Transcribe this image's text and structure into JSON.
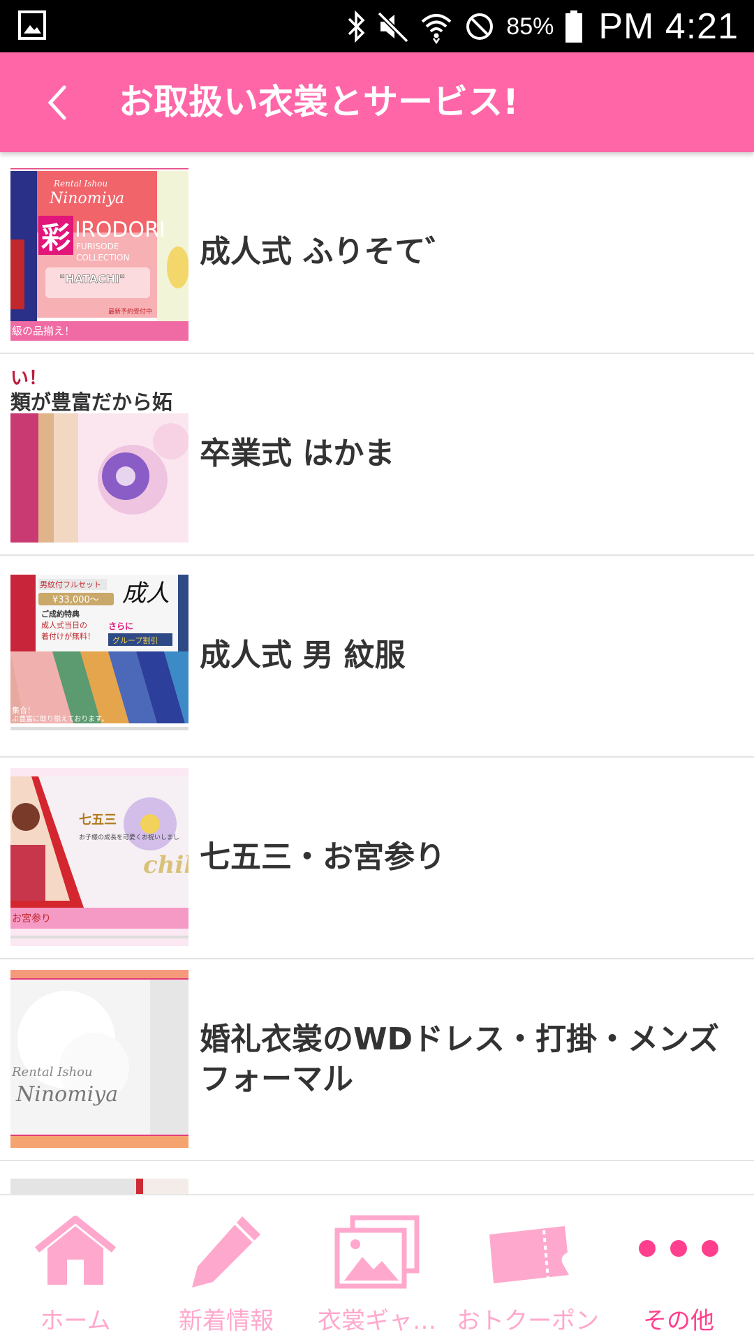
{
  "status_bar": {
    "battery": "85%",
    "time": "PM 4:21",
    "icons": [
      "gallery-icon",
      "bluetooth-icon",
      "mute-icon",
      "wifi-icon",
      "do-not-disturb-icon",
      "battery-icon"
    ]
  },
  "app_bar": {
    "back_icon": "chevron-left-icon",
    "title": "お取扱い衣裳とサービス!",
    "color": "#ff66a8"
  },
  "list": {
    "items": [
      {
        "label": "成人式 ふりそて゛",
        "thumb": {
          "brand": "Rental Ishou",
          "name": "Ninomiya",
          "kanji": "彩",
          "title": "IRODORI",
          "sub1": "FURISODE",
          "sub2": "COLLECTION",
          "tag": "\"HATACHI\"",
          "note": "最新予約受付中",
          "banner": "級の品揃え！"
        }
      },
      {
        "label": "卒業式 はかま",
        "thumb": {
          "top": "い！",
          "headline": "類が豊富だから妬"
        }
      },
      {
        "label": "成人式 男 紋服",
        "thumb": {
          "badge": "男紋付フルセット",
          "price": "¥33,000～",
          "kanji": "成人",
          "perk_title": "ご成約特典",
          "perk1": "成人式当日の",
          "perk2": "着付けが無料！",
          "more": "さらに",
          "group": "グループ割引",
          "foot1": "集合！",
          "foot2": "ぶ豊富に取り揃えております。"
        }
      },
      {
        "label": "七五三・お宮参り",
        "thumb": {
          "title": "七五三",
          "caption": "お子様の成長を可愛くお祝いしまし",
          "deco": "chil",
          "banner": "お宮参り"
        }
      },
      {
        "label": "婚礼衣裳のWDドレス・打掛・メンズフォーマル",
        "thumb": {
          "brand": "Rental Ishou",
          "name": "Ninomiya"
        }
      }
    ]
  },
  "bottom_nav": {
    "items": [
      {
        "label": "ホーム",
        "icon": "home-icon"
      },
      {
        "label": "新着情報",
        "icon": "pencil-icon"
      },
      {
        "label": "衣裳ギャ…",
        "icon": "gallery-icon"
      },
      {
        "label": "おトクーポン",
        "icon": "ticket-icon"
      },
      {
        "label": "その他",
        "icon": "more-icon",
        "active": true
      }
    ],
    "color": "#ffa8cd",
    "active_color": "#ff3f8e"
  }
}
